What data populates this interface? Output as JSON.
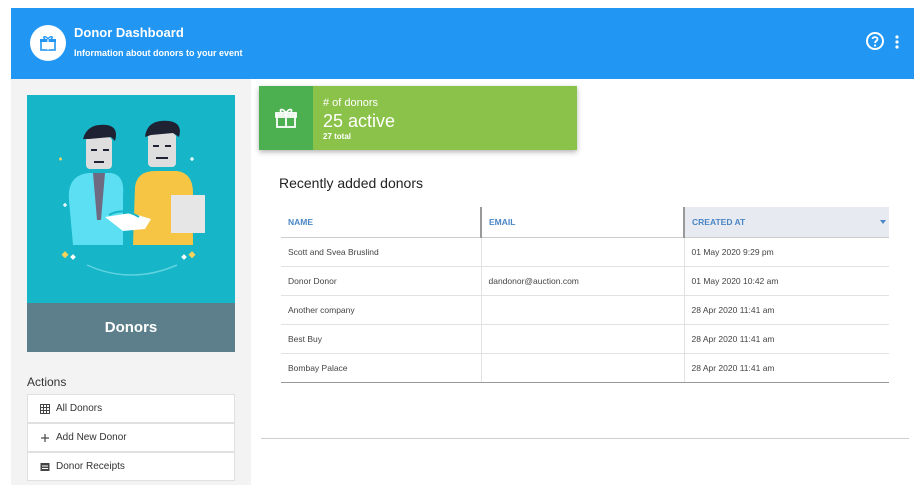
{
  "header": {
    "title": "Donor Dashboard",
    "subtitle": "Information about donors to your event",
    "logo_icon": "gift-icon",
    "help_icon": "help-circle-icon",
    "menu_icon": "more-vert-icon",
    "color": "#2196f3"
  },
  "sidebar": {
    "card_label": "Donors",
    "card_color": "#16b5c8",
    "actions_title": "Actions",
    "actions": [
      {
        "label": "All Donors",
        "icon": "grid-icon"
      },
      {
        "label": "Add New Donor",
        "icon": "plus-icon"
      },
      {
        "label": "Donor Receipts",
        "icon": "receipt-icon"
      }
    ]
  },
  "stat": {
    "label": "# of donors",
    "value": "25 active",
    "total": "27 total",
    "icon": "gift-icon",
    "color": "#8bc34a",
    "icon_bg": "#4caf50"
  },
  "recent": {
    "title": "Recently added donors",
    "columns": [
      "NAME",
      "EMAIL",
      "CREATED AT"
    ],
    "rows": [
      {
        "name": "Scott and Svea Bruslind",
        "email": "",
        "created": "01 May 2020 9:29 pm"
      },
      {
        "name": "Donor Donor",
        "email": "dandonor@auction.com",
        "created": "01 May 2020 10:42 am"
      },
      {
        "name": "Another company",
        "email": "",
        "created": "28 Apr 2020 11:41 am"
      },
      {
        "name": "Best Buy",
        "email": "",
        "created": "28 Apr 2020 11:41 am"
      },
      {
        "name": "Bombay Palace",
        "email": "",
        "created": "28 Apr 2020 11:41 am"
      }
    ]
  }
}
